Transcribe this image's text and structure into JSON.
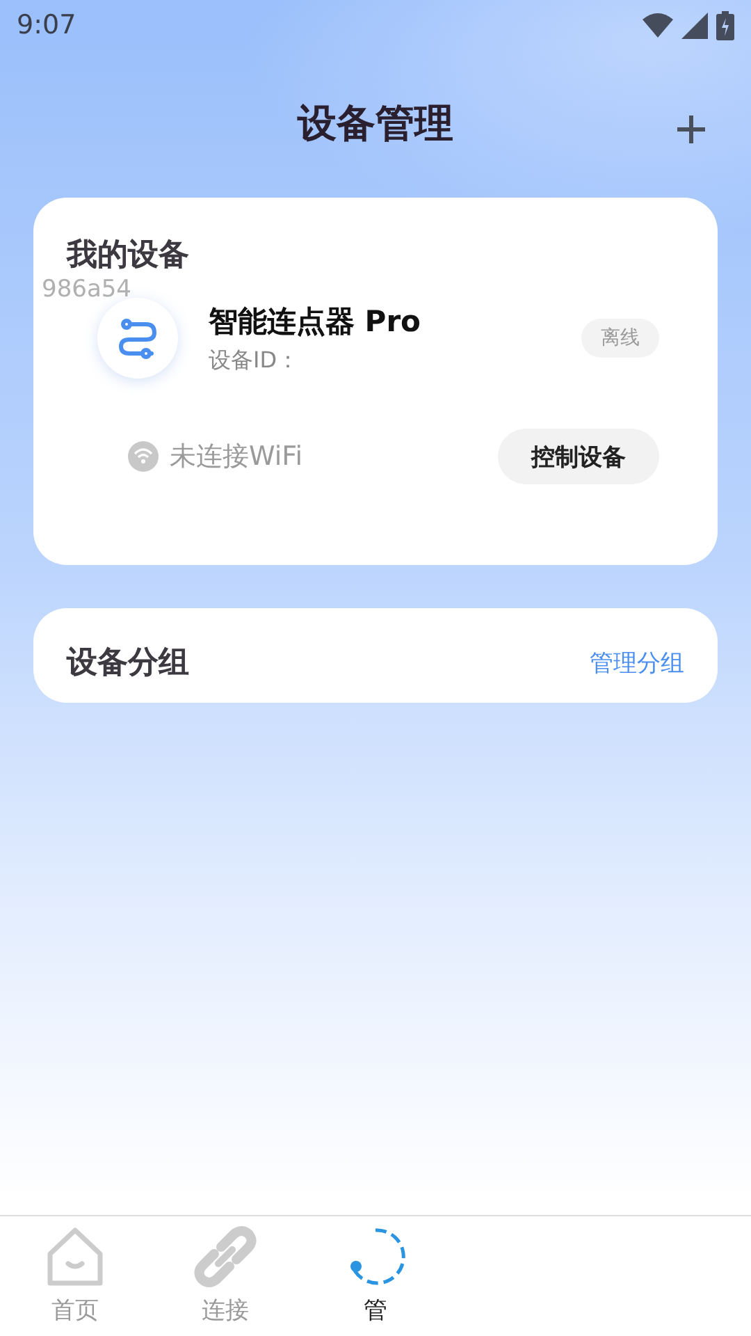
{
  "status_bar": {
    "time": "9:07"
  },
  "header": {
    "title": "设备管理"
  },
  "my_devices": {
    "title": "我的设备",
    "stray_id": "986a54",
    "device": {
      "name": "智能连点器 Pro",
      "id_label": "设备ID：",
      "status": "离线",
      "online": false,
      "wifi": "未连接WiFi",
      "wifi_connected": false,
      "action": "控制设备"
    }
  },
  "groups": {
    "title": "设备分组",
    "action": "管理分组"
  },
  "bottom_nav": [
    {
      "label": "首页",
      "selected": false
    },
    {
      "label": "连接",
      "selected": false
    },
    {
      "label": "管",
      "selected": true
    }
  ]
}
